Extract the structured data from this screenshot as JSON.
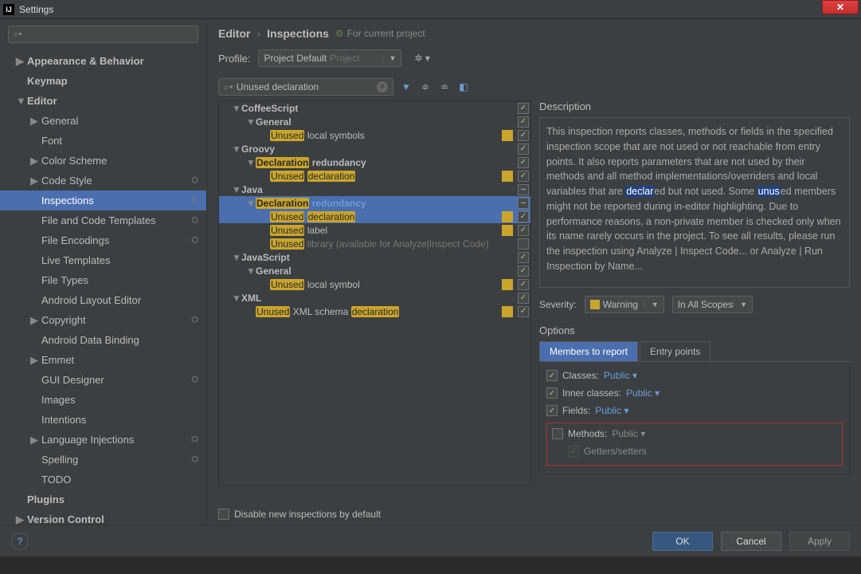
{
  "window": {
    "title": "Settings"
  },
  "sidebar": {
    "search_placeholder": "",
    "items": [
      {
        "label": "Appearance & Behavior",
        "level": 0,
        "bold": true,
        "arrow": "▶"
      },
      {
        "label": "Keymap",
        "level": 0,
        "bold": true
      },
      {
        "label": "Editor",
        "level": 0,
        "bold": true,
        "arrow": "▼"
      },
      {
        "label": "General",
        "level": 1,
        "arrow": "▶"
      },
      {
        "label": "Font",
        "level": 1
      },
      {
        "label": "Color Scheme",
        "level": 1,
        "arrow": "▶"
      },
      {
        "label": "Code Style",
        "level": 1,
        "arrow": "▶",
        "gear": true
      },
      {
        "label": "Inspections",
        "level": 1,
        "gear": true,
        "selected": true
      },
      {
        "label": "File and Code Templates",
        "level": 1,
        "gear": true
      },
      {
        "label": "File Encodings",
        "level": 1,
        "gear": true
      },
      {
        "label": "Live Templates",
        "level": 1
      },
      {
        "label": "File Types",
        "level": 1
      },
      {
        "label": "Android Layout Editor",
        "level": 1
      },
      {
        "label": "Copyright",
        "level": 1,
        "arrow": "▶",
        "gear": true
      },
      {
        "label": "Android Data Binding",
        "level": 1
      },
      {
        "label": "Emmet",
        "level": 1,
        "arrow": "▶"
      },
      {
        "label": "GUI Designer",
        "level": 1,
        "gear": true
      },
      {
        "label": "Images",
        "level": 1
      },
      {
        "label": "Intentions",
        "level": 1
      },
      {
        "label": "Language Injections",
        "level": 1,
        "arrow": "▶",
        "gear": true
      },
      {
        "label": "Spelling",
        "level": 1,
        "gear": true
      },
      {
        "label": "TODO",
        "level": 1
      },
      {
        "label": "Plugins",
        "level": 0,
        "bold": true
      },
      {
        "label": "Version Control",
        "level": 0,
        "bold": true,
        "arrow": "▶"
      }
    ]
  },
  "breadcrumb": {
    "a": "Editor",
    "b": "Inspections",
    "badge": "For current project"
  },
  "profile": {
    "label": "Profile:",
    "value": "Project Default",
    "suffix": "Project"
  },
  "filter": {
    "value": "Unused declaration"
  },
  "inspTree": [
    {
      "d": 0,
      "arrow": "▼",
      "bold": true,
      "plain": "CoffeeScript",
      "ck": "✓"
    },
    {
      "d": 1,
      "arrow": "▼",
      "bold": true,
      "plain": "General",
      "ck": "✓"
    },
    {
      "d": 2,
      "hl": "Unused",
      "after": " local symbols",
      "sq": true,
      "ck": "✓"
    },
    {
      "d": 0,
      "arrow": "▼",
      "bold": true,
      "plain": "Groovy",
      "ck": "✓"
    },
    {
      "d": 1,
      "arrow": "▼",
      "bold": true,
      "hl": "Declaration",
      "after": " redundancy",
      "ck": "✓"
    },
    {
      "d": 2,
      "hl": "Unused",
      "hl2": "declaration",
      "sq": true,
      "ck": "✓"
    },
    {
      "d": 0,
      "arrow": "▼",
      "bold": true,
      "plain": "Java",
      "ck": "−"
    },
    {
      "d": 1,
      "arrow": "▼",
      "bold": true,
      "hl": "Declaration",
      "blue": "redundancy",
      "ck": "−",
      "selected": true
    },
    {
      "d": 2,
      "hl": "Unused",
      "hl2": "declaration",
      "sq": true,
      "ck": "✓",
      "selected": true
    },
    {
      "d": 2,
      "hl": "Unused",
      "after": " label",
      "sq": true,
      "ck": "✓"
    },
    {
      "d": 2,
      "hl": "Unused",
      "gray": " library (available for Analyze|Inspect Code)",
      "ck": " ",
      "unchecked": true
    },
    {
      "d": 0,
      "arrow": "▼",
      "bold": true,
      "plain": "JavaScript",
      "ck": "✓"
    },
    {
      "d": 1,
      "arrow": "▼",
      "bold": true,
      "plain": "General",
      "ck": "✓"
    },
    {
      "d": 2,
      "hl": "Unused",
      "after": " local symbol",
      "sq": true,
      "ck": "✓"
    },
    {
      "d": 0,
      "arrow": "▼",
      "bold": true,
      "plain": "XML",
      "ck": "✓"
    },
    {
      "d": 1,
      "hl": "Unused",
      "after": " XML schema ",
      "hl2": "declaration",
      "sq": true,
      "ck": "✓"
    }
  ],
  "description": {
    "head": "Description",
    "body_pre": "This inspection reports classes, methods or fields in the specified inspection scope that are not used or not reachable from entry points. It also reports parameters that are not used by their methods and all method implementations/overriders and local variables that are ",
    "hl_a": "declar",
    "mid_a": "ed but not used. Some ",
    "hl_b": "unus",
    "body_post": "ed members might not be reported during in-editor highlighting. Due to performance reasons, a non-private member is checked only when its name rarely occurs in the project. To see all results, please run the inspection using Analyze | Inspect Code... or Analyze | Run Inspection by Name..."
  },
  "severity": {
    "label": "Severity:",
    "value": "Warning",
    "scope": "In All Scopes"
  },
  "options": {
    "head": "Options",
    "tab1": "Members to report",
    "tab2": "Entry points",
    "classes": "Classes:",
    "inner": "Inner classes:",
    "fields": "Fields:",
    "methods": "Methods:",
    "getters": "Getters/setters",
    "public": "Public"
  },
  "disable_label": "Disable new inspections by default",
  "buttons": {
    "ok": "OK",
    "cancel": "Cancel",
    "apply": "Apply"
  }
}
